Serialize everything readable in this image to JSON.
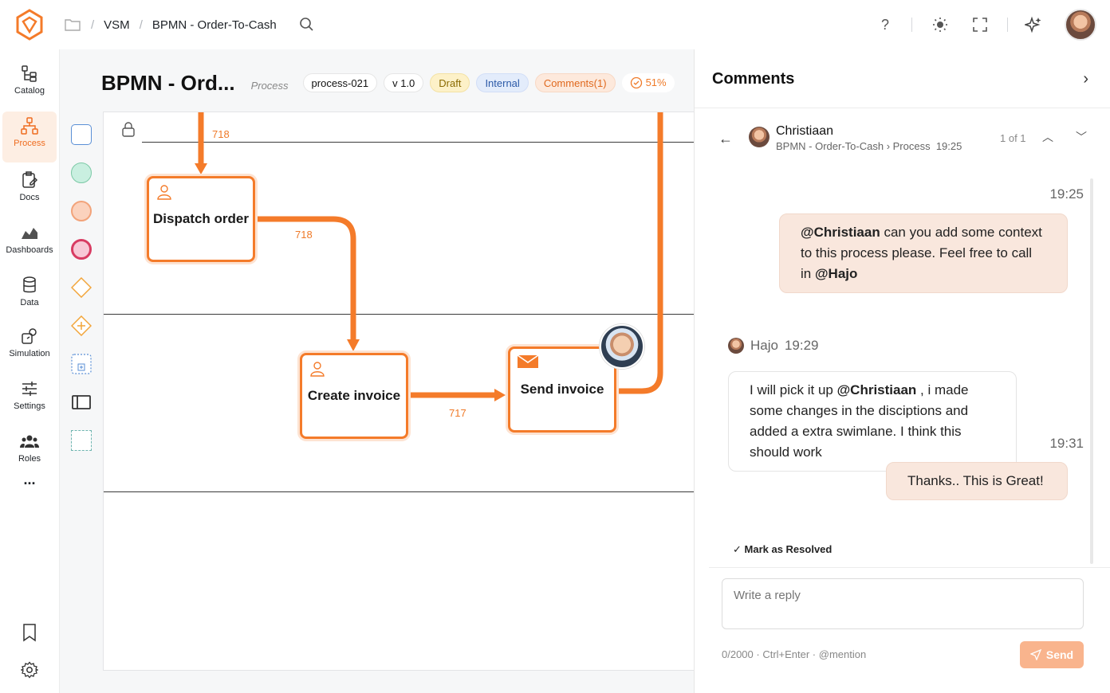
{
  "breadcrumbs": {
    "root": "VSM",
    "current": "BPMN - Order-To-Cash",
    "sep": "/"
  },
  "top_icons": [
    "help-icon",
    "theme-icon",
    "fullscreen-icon",
    "ai-sparkle-icon"
  ],
  "top_help_glyph": "?",
  "nav": [
    {
      "label": "Catalog",
      "icon": "catalog-icon"
    },
    {
      "label": "Process",
      "icon": "process-icon",
      "active": true
    },
    {
      "label": "Docs",
      "icon": "docs-icon"
    },
    {
      "label": "Dashboards",
      "icon": "dashboards-icon"
    },
    {
      "label": "Data",
      "icon": "data-icon"
    },
    {
      "label": "Simulation",
      "icon": "simulation-icon"
    },
    {
      "label": "Settings",
      "icon": "settings-icon"
    },
    {
      "label": "Roles",
      "icon": "roles-icon"
    }
  ],
  "nav_more": "...",
  "header": {
    "title": "BPMN - Ord...",
    "type": "Process",
    "id_chip": "process-021",
    "version": "v 1.0",
    "status": "Draft",
    "visibility": "Internal",
    "comments": "Comments(1)",
    "progress": "51%"
  },
  "diagram": {
    "tasks": [
      {
        "label": "Dispatch order"
      },
      {
        "label": "Create invoice"
      },
      {
        "label": "Send invoice"
      }
    ],
    "flow_labels": [
      "718",
      "718",
      "717"
    ]
  },
  "comments": {
    "title": "Comments",
    "thread": {
      "author": "Christiaan",
      "context": "BPMN - Order-To-Cash › Process",
      "time": "19:25",
      "count": "1 of 1"
    },
    "messages": [
      {
        "time": "19:25",
        "mention": "@Christiaan",
        "text_a": " can you add some context to this process please. Feel free to call in ",
        "mention2": "@Hajo"
      },
      {
        "author": "Hajo",
        "time": "19:29",
        "text_a": "I will pick it up ",
        "mention": "@Christiaan",
        "text_b": " , i made some changes in the disciptions and added a extra swimlane. I think this should work"
      },
      {
        "time": "19:31",
        "text": "Thanks.. This is Great!"
      }
    ],
    "resolve_label": "Mark as Resolved",
    "reply_placeholder": "Write a reply",
    "hint": "0/2000 · Ctrl+Enter · @mention",
    "send_label": "Send"
  },
  "colors": {
    "accent": "#F47B2A",
    "draft_bg": "#FDF1C8",
    "internal_bg": "#E3ECFB",
    "comments_bg": "#FDE9DC",
    "bubble_mine": "#F9E7DD"
  }
}
